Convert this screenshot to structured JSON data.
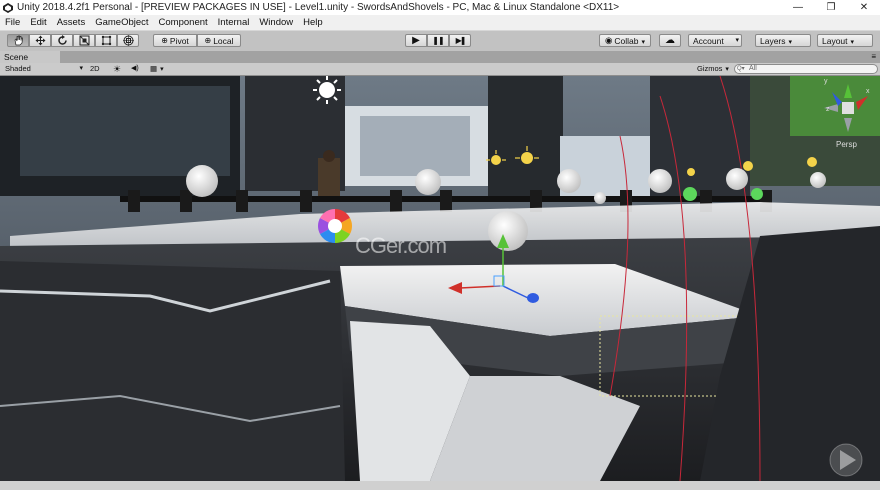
{
  "window": {
    "title": "Unity 2018.4.2f1 Personal - [PREVIEW PACKAGES IN USE] - Level1.unity - SwordsAndShovels - PC, Mac & Linux Standalone <DX11>",
    "minimize": "—",
    "maximize": "❐",
    "close": "✕"
  },
  "menu": [
    "File",
    "Edit",
    "Assets",
    "GameObject",
    "Component",
    "Internal",
    "Window",
    "Help"
  ],
  "toolbar": {
    "tools": [
      "hand-icon",
      "move-icon",
      "rotate-icon",
      "scale-icon",
      "rect-icon",
      "transform-icon"
    ],
    "pivot_label": "Pivot",
    "local_label": "Local",
    "play_glyph": "▶",
    "pause_glyph": "❚❚",
    "step_glyph": "▶❚",
    "collab_label": "Collab",
    "cloud_glyph": "☁",
    "account_label": "Account",
    "layers_label": "Layers",
    "layout_label": "Layout"
  },
  "tabs": {
    "scene": "Scene"
  },
  "scene_toolbar": {
    "shading": "Shaded",
    "mode_2d": "2D",
    "light_glyph": "☀",
    "audio_glyph": "◀)",
    "effects_glyph": "▦",
    "gizmos": "Gizmos",
    "search_placeholder": "All",
    "search_prefix": "Q▾"
  },
  "scene": {
    "watermark": "CGer.com",
    "projection": "Persp",
    "gizmo_axes": {
      "x": "x",
      "y": "y",
      "z": "z"
    }
  },
  "colors": {
    "title_bg": "#ffffff",
    "menu_bg": "#f0f0f0",
    "toolbar_bg": "#c2c2c2",
    "axis_x": "#d0302a",
    "axis_y": "#57c238",
    "axis_z": "#2f5be0"
  }
}
